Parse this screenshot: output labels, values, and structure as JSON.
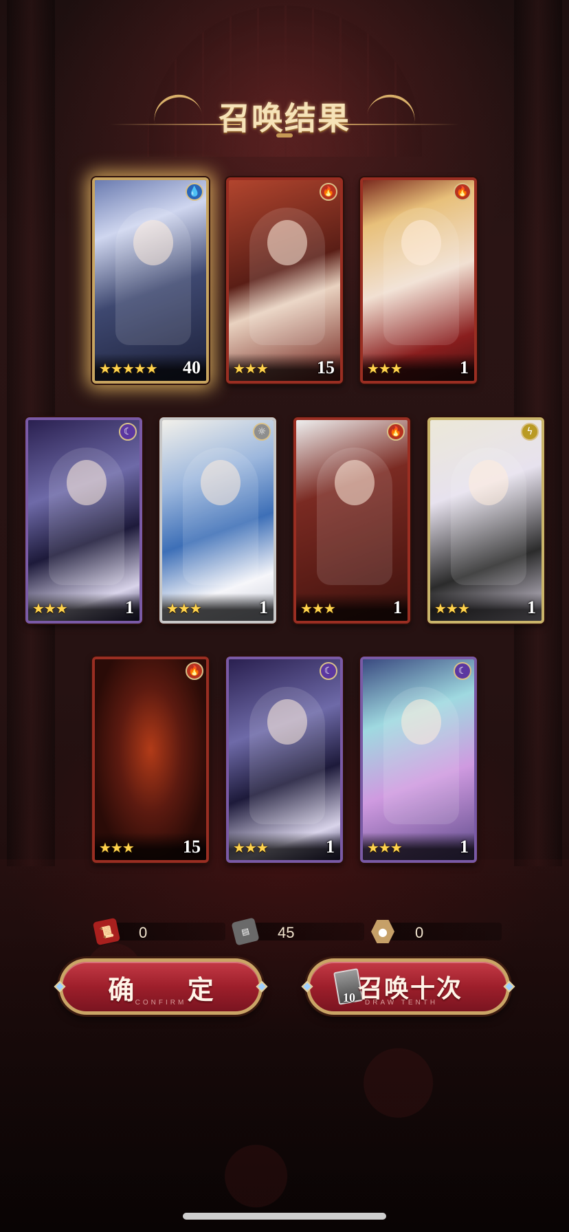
{
  "title": "召唤结果",
  "cards": [
    {
      "element": "water-icon",
      "stars": "★★★★★",
      "count": "40"
    },
    {
      "element": "fire-icon",
      "stars": "★★★",
      "count": "15"
    },
    {
      "element": "fire-icon",
      "stars": "★★★",
      "count": "1"
    },
    {
      "element": "moon-icon",
      "stars": "★★★",
      "count": "1"
    },
    {
      "element": "light-icon",
      "stars": "★★★",
      "count": "1"
    },
    {
      "element": "fire-icon",
      "stars": "★★★",
      "count": "1"
    },
    {
      "element": "thunder-icon",
      "stars": "★★★",
      "count": "1"
    },
    {
      "element": "fire-icon",
      "stars": "★★★",
      "count": "15"
    },
    {
      "element": "moon-icon",
      "stars": "★★★",
      "count": "1"
    },
    {
      "element": "moon-icon",
      "stars": "★★★",
      "count": "1"
    }
  ],
  "resources": [
    {
      "icon": "scroll-icon",
      "value": "0"
    },
    {
      "icon": "ticket-icon",
      "value": "45"
    },
    {
      "icon": "hexagon-token-icon",
      "value": "0"
    }
  ],
  "buttons": {
    "confirm_label": "确 定",
    "confirm_sub": "CONFIRM",
    "draw_label": "召唤十次",
    "draw_sub": "DRAW TENTH",
    "draw_ticket_count": "10"
  },
  "colors": {
    "accent_gold": "#caa566",
    "button_red": "#9e1f2b",
    "star_yellow": "#ffd34d"
  }
}
